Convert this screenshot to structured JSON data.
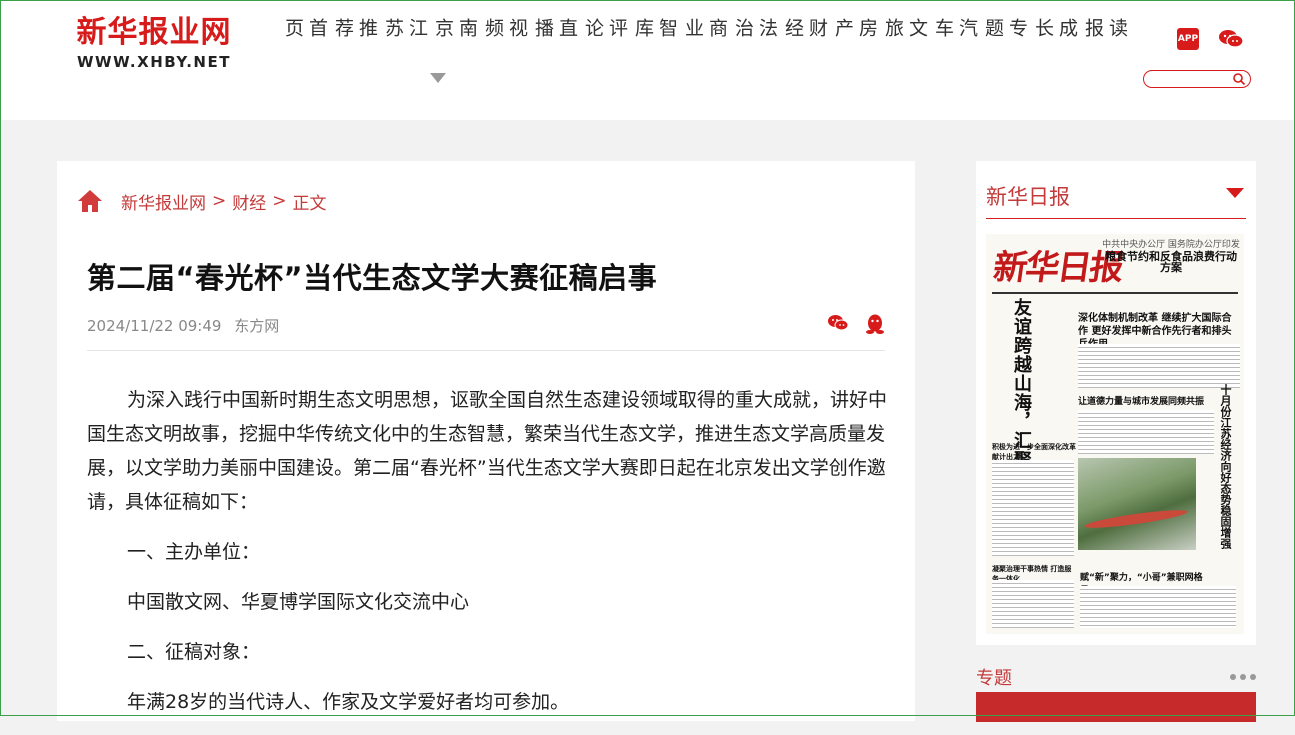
{
  "site": {
    "logo_main": "新华报业网",
    "logo_sub": "WWW.XHBY.NET",
    "app_label": "APP"
  },
  "nav": {
    "items": [
      {
        "c1": "首",
        "c2": "页"
      },
      {
        "c1": "推",
        "c2": "荐"
      },
      {
        "c1": "江",
        "c2": "苏"
      },
      {
        "c1": "南",
        "c2": "京"
      },
      {
        "c1": "视",
        "c2": "频"
      },
      {
        "c1": "直",
        "c2": "播"
      },
      {
        "c1": "评",
        "c2": "论"
      },
      {
        "c1": "智",
        "c2": "库"
      },
      {
        "c1": "商",
        "c2": "业"
      },
      {
        "c1": "法",
        "c2": "治"
      },
      {
        "c1": "财",
        "c2": "经"
      },
      {
        "c1": "房",
        "c2": "产"
      },
      {
        "c1": "文",
        "c2": "旅"
      },
      {
        "c1": "汽",
        "c2": "车"
      },
      {
        "c1": "专",
        "c2": "题"
      },
      {
        "c1": "成",
        "c2": "长"
      },
      {
        "c1": "读",
        "c2": "报"
      }
    ]
  },
  "breadcrumb": {
    "home": "新华报业网",
    "sep1": ">",
    "section": "财经",
    "sep2": ">",
    "current": "正文"
  },
  "article": {
    "title": "第二届“春光杯”当代生态文学大赛征稿启事",
    "datetime": "2024/11/22 09:49",
    "source": "东方网",
    "paragraphs": [
      "为深入践行中国新时期生态文明思想，讴歌全国自然生态建设领域取得的重大成就，讲好中国生态文明故事，挖掘中华传统文化中的生态智慧，繁荣当代生态文学，推进生态文学高质量发展，以文学助力美丽中国建设。第二届“春光杯”当代生态文学大赛即日起在北京发出文学创作邀请，具体征稿如下：",
      "一、主办单位：",
      "中国散文网、华夏博学国际文化交流中心",
      "二、征稿对象：",
      "年满28岁的当代诗人、作家及文学爱好者均可参加。"
    ]
  },
  "sidebar": {
    "title": "新华日报",
    "topic_title": "专题",
    "paper": {
      "masthead": "新华日报",
      "top_sub": "中共中央办公厅 国务院办公厅印发",
      "top_head": "粮食节约和反食品浪费行动方案",
      "vert_head": "友谊跨越山海，汇聚美好期待",
      "head1": "深化体制机制改革 继续扩大国际合作 更好发挥中新合作先行者和排头兵作用",
      "head2": "让道德力量与城市发展同频共振",
      "right_vert": "十月份江苏经济向好态势稳固增强",
      "head3": "赋“新”聚力，“小哥”兼职网格员",
      "head4": "凝聚治理干事热情 打造服务一体化",
      "head5": "积极为进一步全面深化改革献计出力"
    }
  }
}
